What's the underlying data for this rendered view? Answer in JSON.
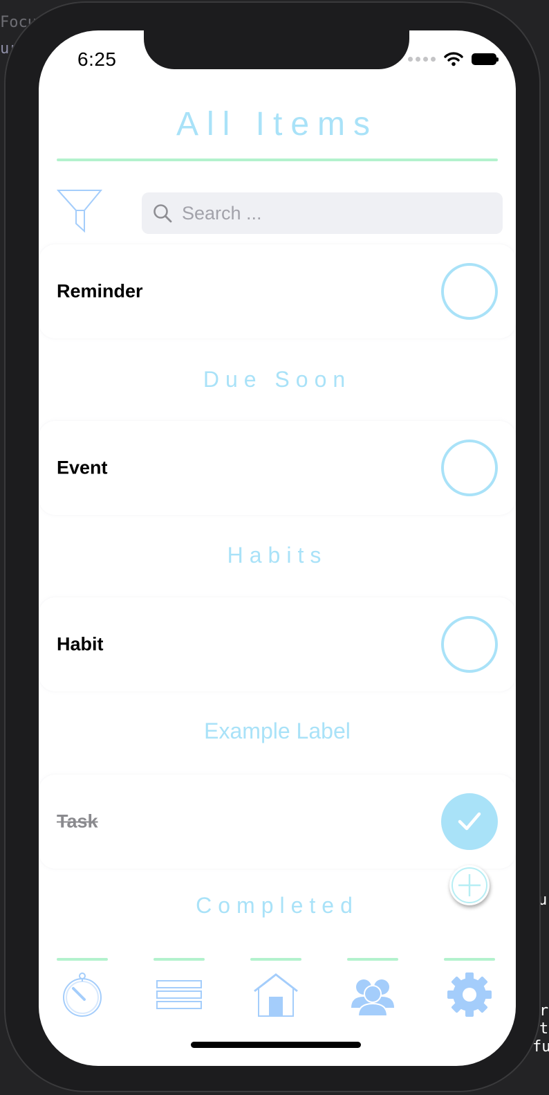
{
  "background_fragments": [
    "Focu",
    "ur",
    "u",
    "r",
    "t",
    "fu"
  ],
  "status_bar": {
    "time": "6:25"
  },
  "header": {
    "title": "All Items"
  },
  "search": {
    "placeholder": "Search ..."
  },
  "rows": [
    {
      "label": "Reminder",
      "checked": false
    },
    {
      "label": "Event",
      "checked": false
    },
    {
      "label": "Habit",
      "checked": false
    },
    {
      "label": "Task",
      "checked": true
    }
  ],
  "sections": [
    "Due Soon",
    "Habits",
    "Example Label",
    "Completed"
  ],
  "tabs": [
    "timer-icon",
    "list-icon",
    "home-icon",
    "people-icon",
    "gear-icon"
  ],
  "colors": {
    "accent": "#a9e2f8",
    "rule": "#b3f2cd",
    "tab_icon": "#a4cdfb"
  }
}
